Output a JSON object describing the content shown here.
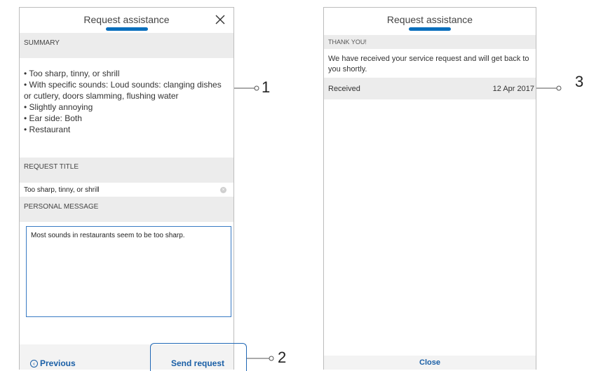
{
  "screen1": {
    "title": "Request assistance",
    "summary_heading": "SUMMARY",
    "summary_items": [
      "• Too sharp, tinny, or shrill",
      "• With specific sounds: Loud sounds: clanging dishes or cutlery, doors slamming, flushing water",
      "• Slightly annoying",
      "• Ear side: Both",
      "• Restaurant"
    ],
    "request_title_heading": "REQUEST TITLE",
    "request_title_value": "Too sharp, tinny, or shrill",
    "personal_message_heading": "PERSONAL MESSAGE",
    "personal_message_value": "Most sounds in restaurants seem to be too sharp.",
    "previous_label": "Previous",
    "send_label": "Send request"
  },
  "screen2": {
    "title": "Request assistance",
    "thanks_heading": "THANK YOU!",
    "message": "We have received your service request and will get back to you shortly.",
    "received_label": "Received",
    "received_date": "12 Apr 2017",
    "close_label": "Close"
  },
  "callouts": [
    "1",
    "2",
    "3"
  ],
  "colors": {
    "accent": "#0a6fbd",
    "link": "#1a5fa6",
    "section_bg": "#ececec",
    "highlight": "#1f67b5"
  }
}
